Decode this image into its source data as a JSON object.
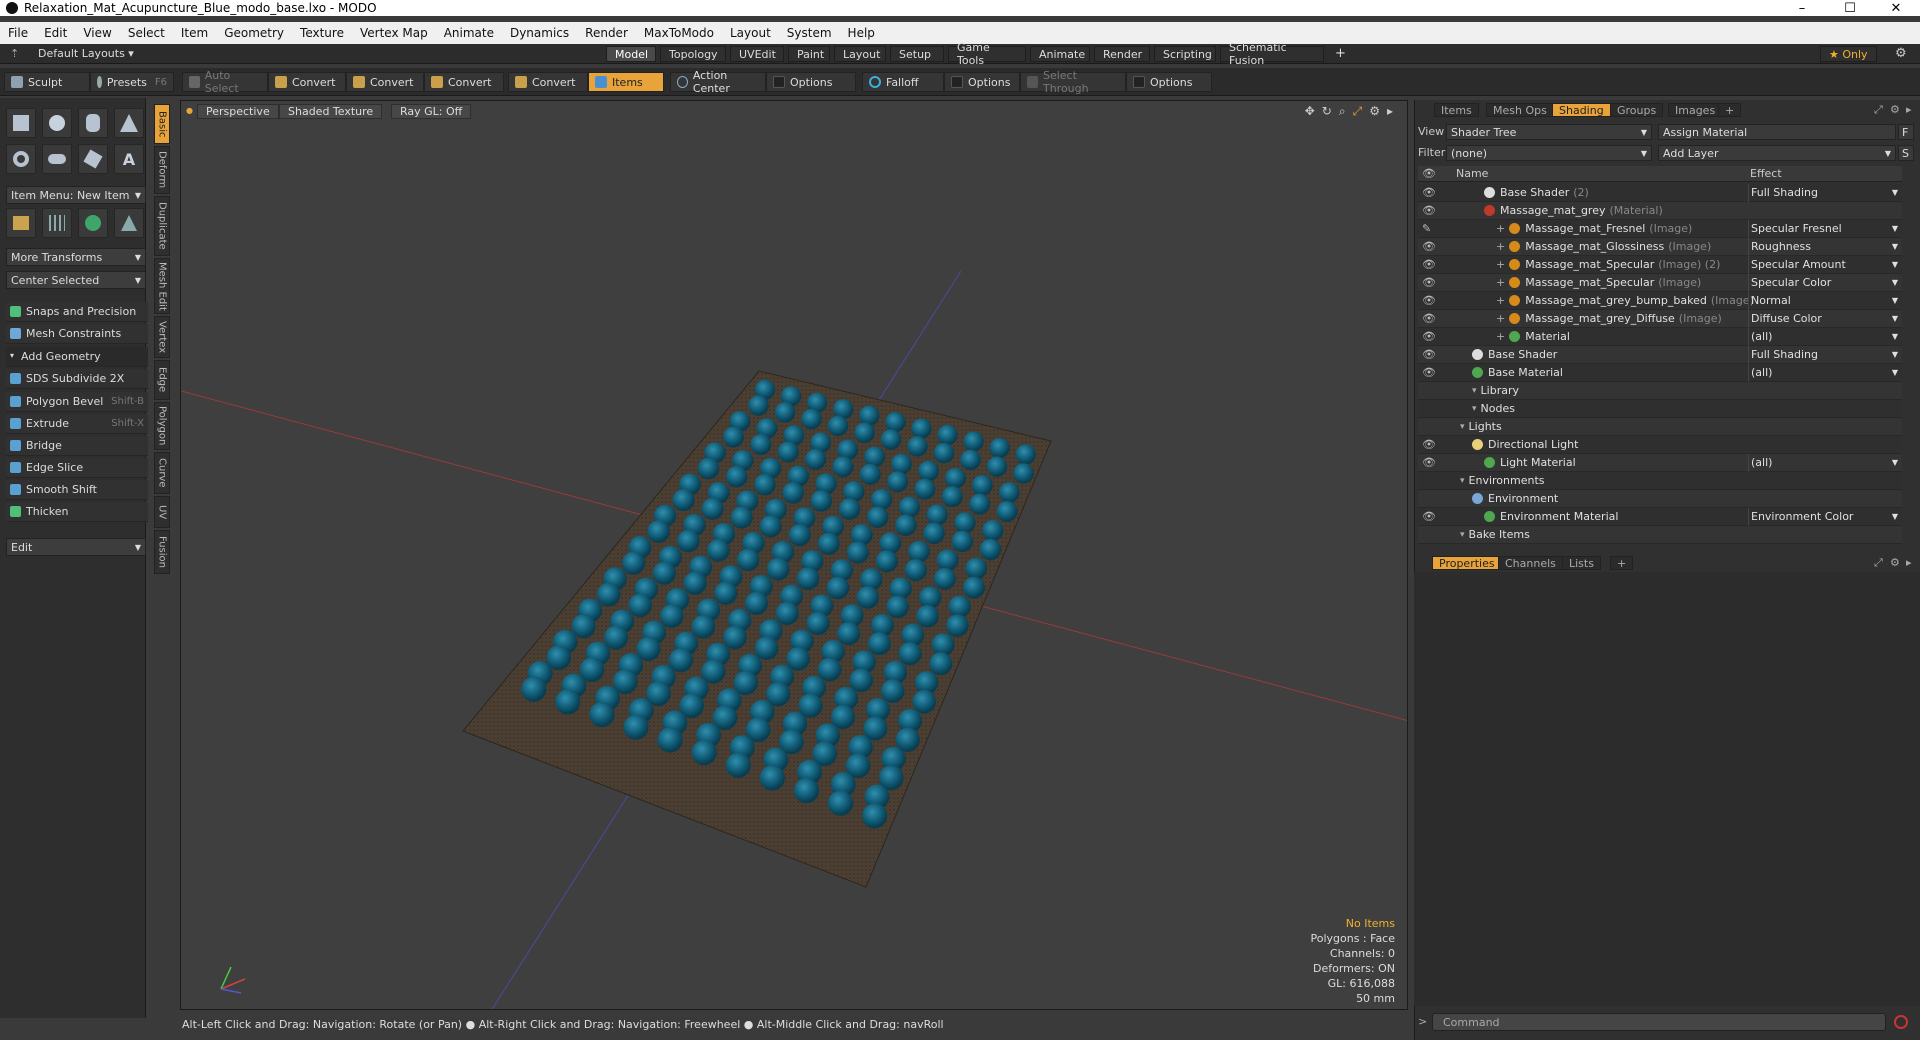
{
  "window": {
    "title": "Relaxation_Mat_Acupuncture_Blue_modo_base.lxo - MODO",
    "minimize": "–",
    "maximize": "☐",
    "close": "✕"
  },
  "menu": [
    "File",
    "Edit",
    "View",
    "Select",
    "Item",
    "Geometry",
    "Texture",
    "Vertex Map",
    "Animate",
    "Dynamics",
    "Render",
    "MaxToModo",
    "Layout",
    "System",
    "Help"
  ],
  "layout": {
    "preset": "Default Layouts ▾",
    "tabs": [
      "Model",
      "Topology",
      "UVEdit",
      "Paint",
      "Layout",
      "Setup",
      "Game Tools",
      "Animate",
      "Render",
      "Scripting",
      "Schematic Fusion"
    ],
    "add": "+",
    "only": "★ Only"
  },
  "toolbar": {
    "sculpt": "Sculpt",
    "presets": "Presets",
    "presets_key": "F6",
    "auto_select": "Auto Select",
    "convert": "Convert",
    "items": "Items",
    "action_center": "Action Center",
    "options": "Options",
    "falloff": "Falloff",
    "select_through": "Select Through"
  },
  "left": {
    "item_menu": "Item Menu: New Item",
    "more_transforms": "More Transforms",
    "center_selected": "Center Selected",
    "tools": [
      {
        "label": "Snaps and Precision",
        "key": ""
      },
      {
        "label": "Mesh Constraints",
        "key": ""
      },
      {
        "label": "Add Geometry",
        "key": ""
      },
      {
        "label": "SDS Subdivide 2X",
        "key": ""
      },
      {
        "label": "Polygon Bevel",
        "key": "Shift-B"
      },
      {
        "label": "Extrude",
        "key": "Shift-X"
      },
      {
        "label": "Bridge",
        "key": ""
      },
      {
        "label": "Edge Slice",
        "key": ""
      },
      {
        "label": "Smooth Shift",
        "key": ""
      },
      {
        "label": "Thicken",
        "key": ""
      }
    ],
    "edit": "Edit",
    "sidetabs": [
      "Basic",
      "Deform",
      "Duplicate",
      "Mesh Edit",
      "Vertex",
      "Edge",
      "Polygon",
      "Curve",
      "UV",
      "Fusion"
    ]
  },
  "viewport": {
    "perspective": "Perspective",
    "shading": "Shaded Texture",
    "raygl": "Ray GL: Off",
    "info": {
      "no_items": "No Items",
      "polygons": "Polygons : Face",
      "channels": "Channels: 0",
      "deformers": "Deformers: ON",
      "gl": "GL: 616,088",
      "size": "50 mm"
    }
  },
  "status": "Alt-Left Click and Drag: Navigation: Rotate (or Pan) ● Alt-Right Click and Drag: Navigation: Freewheel ● Alt-Middle Click and Drag: navRoll",
  "right": {
    "tabs": [
      "Items",
      "Mesh Ops",
      "Shading",
      "Groups",
      "Images",
      "+"
    ],
    "view_label": "View",
    "view_value": "Shader Tree",
    "assign": "Assign Material",
    "filter_label": "Filter",
    "filter_value": "(none)",
    "add_layer": "Add Layer",
    "col_name": "Name",
    "col_effect": "Effect",
    "rows": [
      {
        "name": "Base Shader",
        "sub": "(2)",
        "effect": "Full Shading",
        "indent": 3,
        "color": "#dddddd"
      },
      {
        "name": "Massage_mat_grey",
        "sub": "(Material)",
        "effect": "",
        "indent": 3,
        "color": "#c0392b"
      },
      {
        "name": "Massage_mat_Fresnel",
        "sub": "(Image)",
        "effect": "Specular Fresnel",
        "indent": 4,
        "color": "#d58a1a"
      },
      {
        "name": "Massage_mat_Glossiness",
        "sub": "(Image)",
        "effect": "Roughness",
        "indent": 4,
        "color": "#d58a1a"
      },
      {
        "name": "Massage_mat_Specular",
        "sub": "(Image) (2)",
        "effect": "Specular Amount",
        "indent": 4,
        "color": "#d58a1a"
      },
      {
        "name": "Massage_mat_Specular",
        "sub": "(Image)",
        "effect": "Specular Color",
        "indent": 4,
        "color": "#d58a1a"
      },
      {
        "name": "Massage_mat_grey_bump_baked",
        "sub": "(Image)",
        "effect": "Normal",
        "indent": 4,
        "color": "#d58a1a"
      },
      {
        "name": "Massage_mat_grey_Diffuse",
        "sub": "(Image)",
        "effect": "Diffuse Color",
        "indent": 4,
        "color": "#d58a1a"
      },
      {
        "name": "Material",
        "sub": "",
        "effect": "(all)",
        "indent": 4,
        "color": "#4fa84f"
      },
      {
        "name": "Base Shader",
        "sub": "",
        "effect": "Full Shading",
        "indent": 2,
        "color": "#dddddd"
      },
      {
        "name": "Base Material",
        "sub": "",
        "effect": "(all)",
        "indent": 2,
        "color": "#4fa84f"
      },
      {
        "name": "Library",
        "sub": "",
        "effect": "",
        "indent": 2,
        "color": ""
      },
      {
        "name": "Nodes",
        "sub": "",
        "effect": "",
        "indent": 2,
        "color": ""
      },
      {
        "name": "Lights",
        "sub": "",
        "effect": "",
        "indent": 1,
        "color": ""
      },
      {
        "name": "Directional Light",
        "sub": "",
        "effect": "",
        "indent": 2,
        "color": "#e8d07a"
      },
      {
        "name": "Light Material",
        "sub": "",
        "effect": "(all)",
        "indent": 3,
        "color": "#4fa84f"
      },
      {
        "name": "Environments",
        "sub": "",
        "effect": "",
        "indent": 1,
        "color": ""
      },
      {
        "name": "Environment",
        "sub": "",
        "effect": "",
        "indent": 2,
        "color": "#7aa6d8"
      },
      {
        "name": "Environment Material",
        "sub": "",
        "effect": "Environment Color",
        "indent": 3,
        "color": "#4fa84f"
      },
      {
        "name": "Bake Items",
        "sub": "",
        "effect": "",
        "indent": 1,
        "color": ""
      }
    ],
    "bottom_tabs": [
      "Properties",
      "Channels",
      "Lists",
      "+"
    ],
    "command": "Command"
  }
}
